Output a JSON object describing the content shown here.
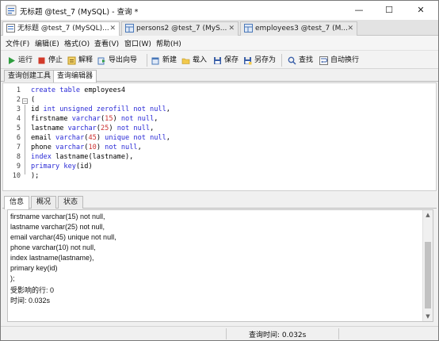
{
  "window": {
    "title": "无标题 @test_7 (MySQL) - 查询 *",
    "controls": {
      "minimize": "—",
      "maximize": "☐",
      "close": "✕"
    }
  },
  "tabs": [
    {
      "label": "无标题 @test_7 (MySQL)...",
      "icon": "query-icon",
      "active": true
    },
    {
      "label": "persons2 @test_7 (MyS...",
      "icon": "table-icon",
      "active": false
    },
    {
      "label": "employees3 @test_7 (M...",
      "icon": "table-icon",
      "active": false
    }
  ],
  "tab_close": "✕",
  "menu": [
    "文件(F)",
    "编辑(E)",
    "格式(O)",
    "查看(V)",
    "窗口(W)",
    "帮助(H)"
  ],
  "toolbar": {
    "run": "运行",
    "stop": "停止",
    "explain": "解释",
    "export_wizard": "导出向导",
    "new": "新建",
    "load": "载入",
    "save": "保存",
    "save_as": "另存为",
    "find": "查找",
    "auto_wrap": "自动换行"
  },
  "subtabs": [
    "查询创建工具",
    "查询编辑器"
  ],
  "editor": {
    "line_numbers": [
      "1",
      "2",
      "3",
      "4",
      "5",
      "6",
      "7",
      "8",
      "9",
      "10"
    ]
  },
  "bottom_tabs": [
    "信息",
    "概况",
    "状态"
  ],
  "messages": [
    "firstname varchar(15) not null,",
    "lastname varchar(25) not null,",
    "email varchar(45) unique not null,",
    "phone varchar(10) not null,",
    "index lastname(lastname),",
    "primary key(id)",
    ");",
    "受影响的行: 0",
    "时间: 0.032s"
  ],
  "status": {
    "query_time": "查询时间: 0.032s"
  },
  "colors": {
    "keyword": "#2a2ad6",
    "number": "#cc3333"
  }
}
